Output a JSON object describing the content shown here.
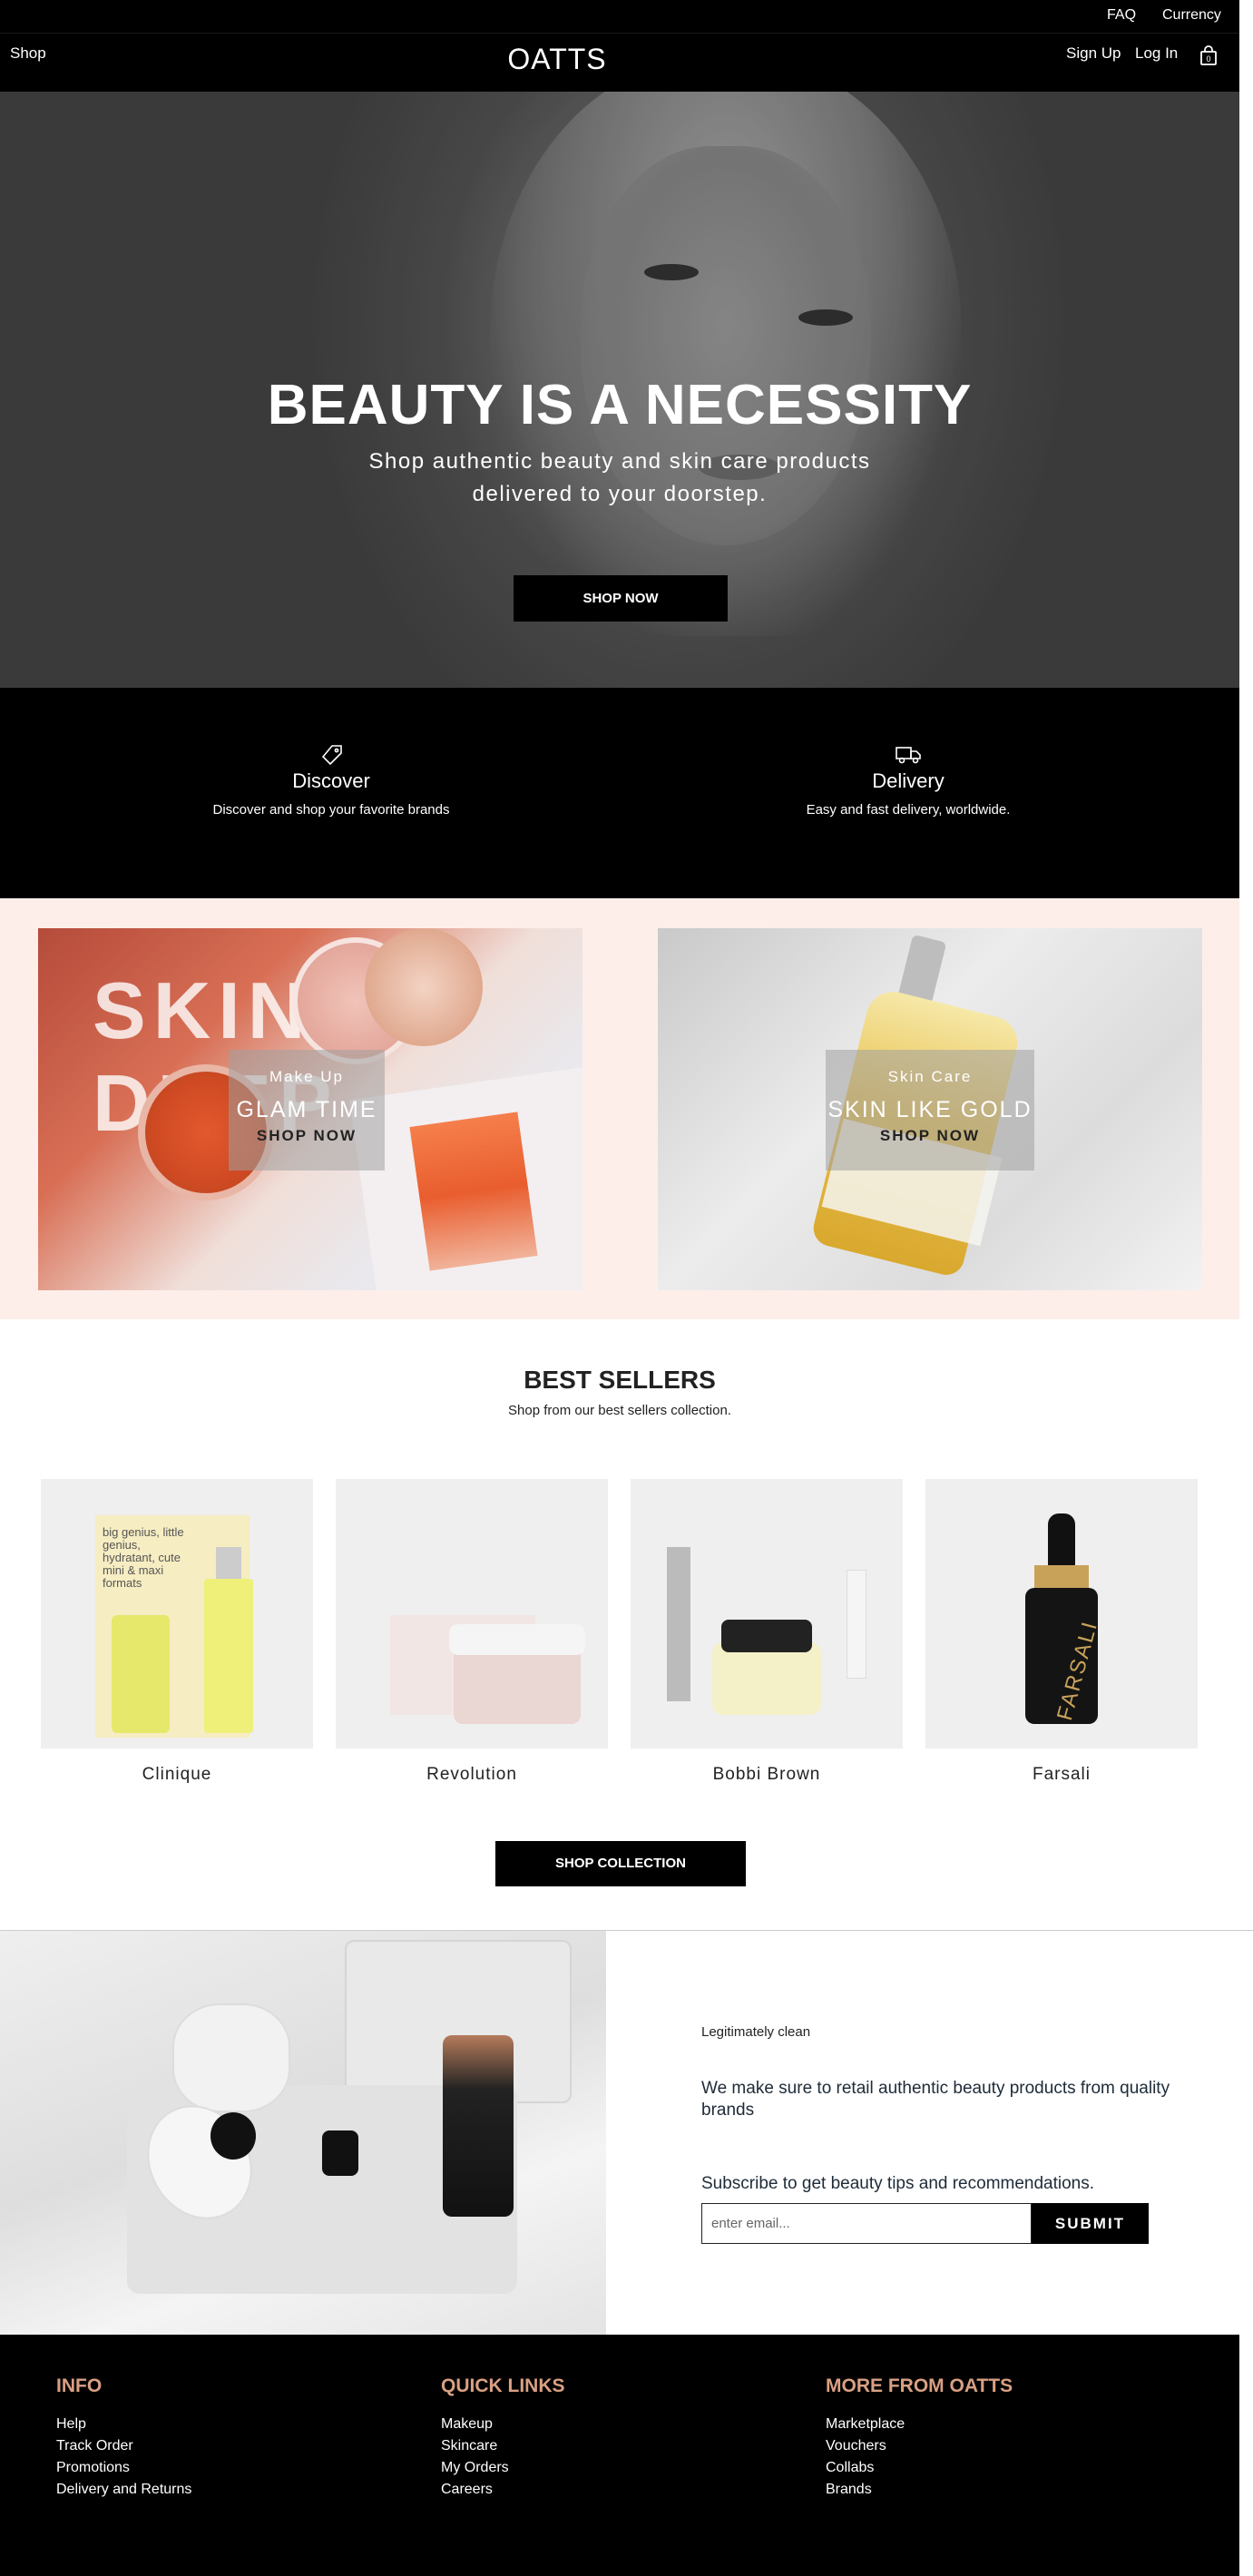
{
  "topbar": {
    "faq": "FAQ",
    "currency": "Currency"
  },
  "nav": {
    "shop": "Shop",
    "logo": "OATTS",
    "signup": "Sign Up",
    "login": "Log In",
    "bag_icon": "shopping-bag-icon"
  },
  "hero": {
    "title": "BEAUTY IS A NECESSITY",
    "subtitle": "Shop authentic beauty and skin care products delivered to your doorstep.",
    "cta": "SHOP NOW"
  },
  "features": [
    {
      "icon": "tag-icon",
      "title": "Discover",
      "desc": "Discover and shop your favorite brands"
    },
    {
      "icon": "truck-icon",
      "title": "Delivery",
      "desc": "Easy and fast delivery, worldwide."
    }
  ],
  "categories": [
    {
      "kicker": "Make Up",
      "title": "GLAM TIME",
      "cta": "SHOP NOW",
      "image_text": "SKIN DEEP"
    },
    {
      "kicker": "Skin Care",
      "title": "SKIN LIKE GOLD",
      "cta": "SHOP NOW"
    }
  ],
  "best_sellers": {
    "title": "BEST SELLERS",
    "subtitle": "Shop from our best sellers collection.",
    "products": [
      {
        "name": "Clinique",
        "image_text": "big genius, little genius, hydratant, cute mini & maxi formats"
      },
      {
        "name": "Revolution"
      },
      {
        "name": "Bobbi Brown"
      },
      {
        "name": "Farsali",
        "image_text": "FARSALI"
      }
    ],
    "cta": "SHOP COLLECTION"
  },
  "newsletter": {
    "kicker": "Legitimately clean",
    "text": "We make sure to retail authentic beauty products from quality brands",
    "subscribe": "Subscribe to get beauty tips and recommendations.",
    "placeholder": "enter email...",
    "submit": "SUBMIT"
  },
  "footer": {
    "accent": "#d9a082",
    "columns": [
      {
        "head": "INFO",
        "links": [
          "Help",
          "Track Order",
          "Promotions",
          "Delivery and Returns"
        ]
      },
      {
        "head": "QUICK LINKS",
        "links": [
          "Makeup",
          "Skincare",
          "My Orders",
          "Careers"
        ]
      },
      {
        "head": "MORE FROM OATTS",
        "links": [
          "Marketplace",
          "Vouchers",
          "Collabs",
          "Brands"
        ]
      }
    ]
  },
  "colors": {
    "black": "#000000",
    "pink_bg": "#fdeeea",
    "accent": "#d9a082"
  }
}
